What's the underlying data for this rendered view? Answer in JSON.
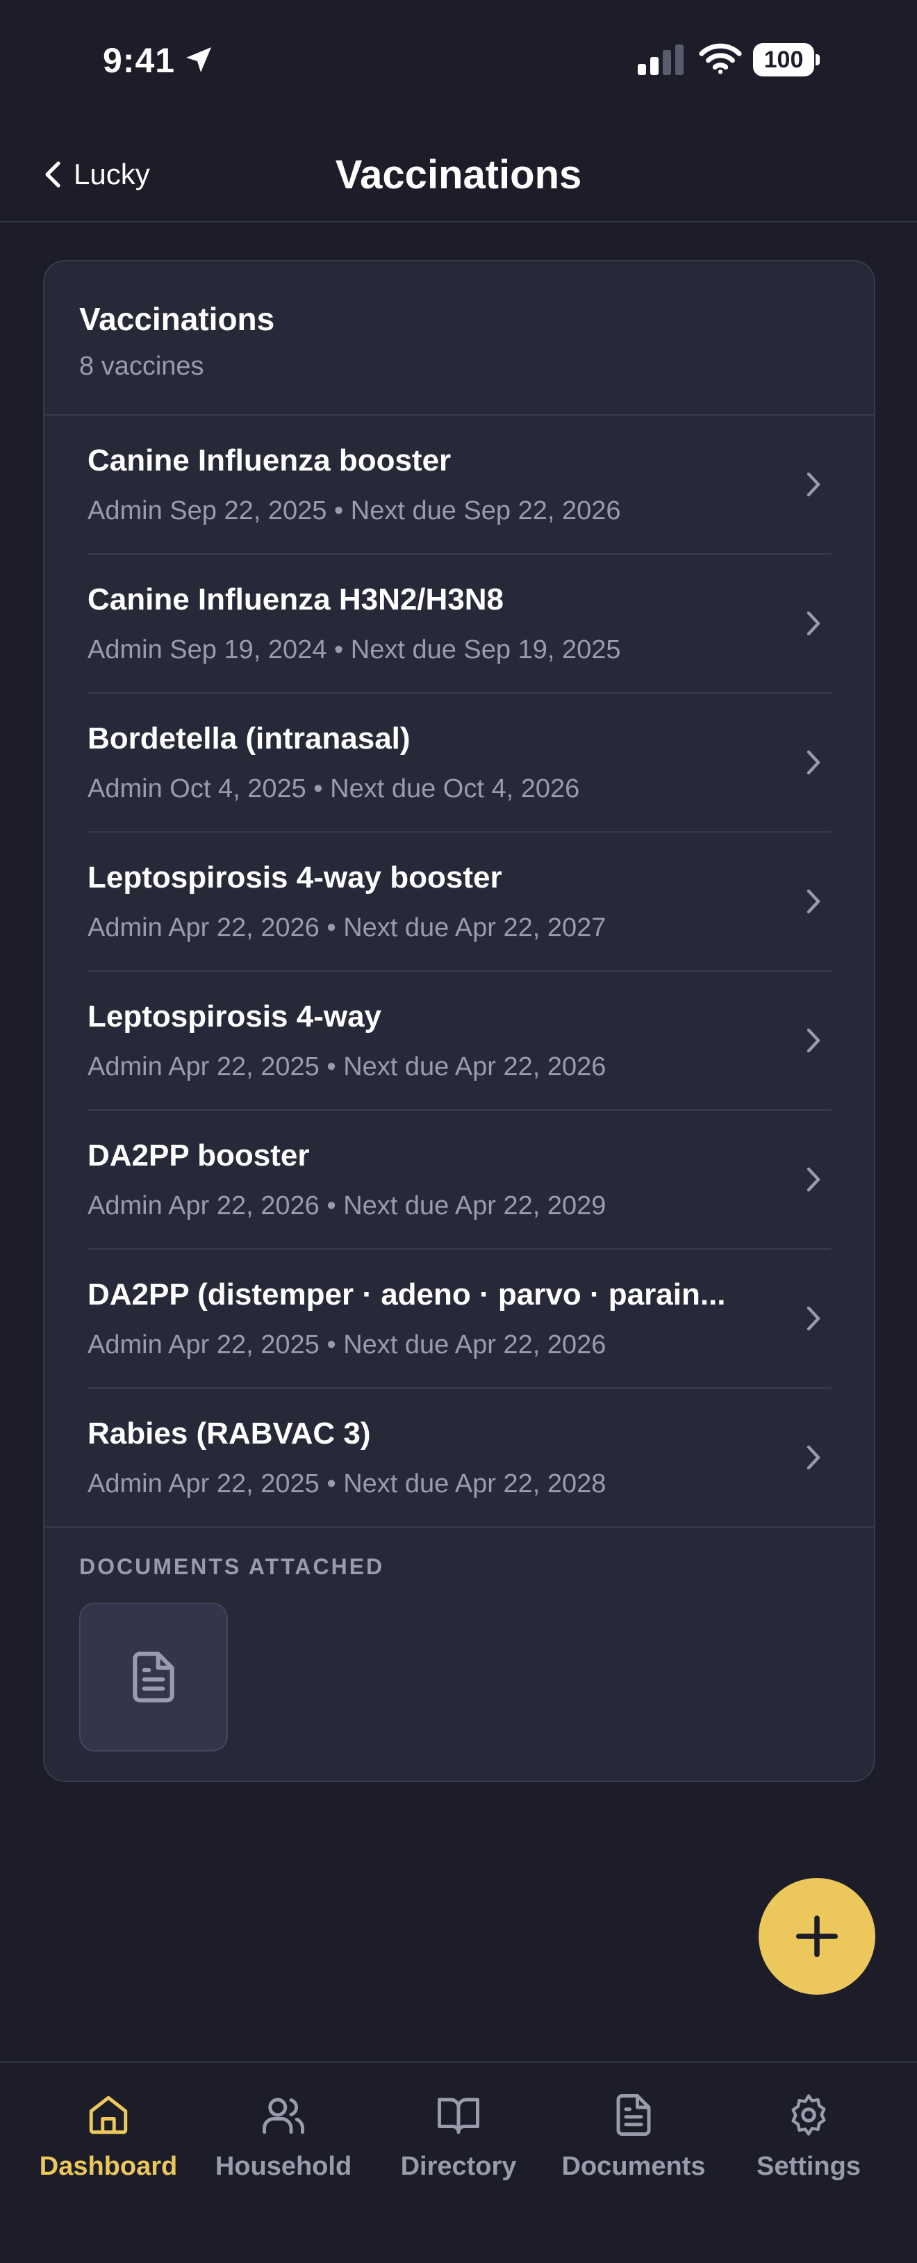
{
  "status_bar": {
    "time": "9:41",
    "battery": "100"
  },
  "nav": {
    "back_label": "Lucky",
    "title": "Vaccinations"
  },
  "card": {
    "title": "Vaccinations",
    "subtitle": "8 vaccines",
    "vaccines": [
      {
        "name": "Canine Influenza booster",
        "dates": "Admin Sep 22, 2025 • Next due Sep 22, 2026"
      },
      {
        "name": "Canine Influenza H3N2/H3N8",
        "dates": "Admin Sep 19, 2024 • Next due Sep 19, 2025"
      },
      {
        "name": "Bordetella (intranasal)",
        "dates": "Admin Oct 4, 2025 • Next due Oct 4, 2026"
      },
      {
        "name": "Leptospirosis 4-way booster",
        "dates": "Admin Apr 22, 2026 • Next due Apr 22, 2027"
      },
      {
        "name": "Leptospirosis 4-way",
        "dates": "Admin Apr 22, 2025 • Next due Apr 22, 2026"
      },
      {
        "name": "DA2PP booster",
        "dates": "Admin Apr 22, 2026 • Next due Apr 22, 2029"
      },
      {
        "name": "DA2PP (distemper · adeno · parvo · parain...",
        "dates": "Admin Apr 22, 2025 • Next due Apr 22, 2026"
      },
      {
        "name": "Rabies (RABVAC 3)",
        "dates": "Admin Apr 22, 2025 • Next due Apr 22, 2028"
      }
    ],
    "documents_label": "DOCUMENTS ATTACHED"
  },
  "tabs": [
    {
      "label": "Dashboard",
      "icon": "home-icon",
      "active": true
    },
    {
      "label": "Household",
      "icon": "users-icon",
      "active": false
    },
    {
      "label": "Directory",
      "icon": "book-icon",
      "active": false
    },
    {
      "label": "Documents",
      "icon": "document-icon",
      "active": false
    },
    {
      "label": "Settings",
      "icon": "gear-icon",
      "active": false
    }
  ],
  "colors": {
    "background": "#1c1d28",
    "card": "#272938",
    "accent": "#ecc85c",
    "muted_text": "#9a9cad"
  }
}
